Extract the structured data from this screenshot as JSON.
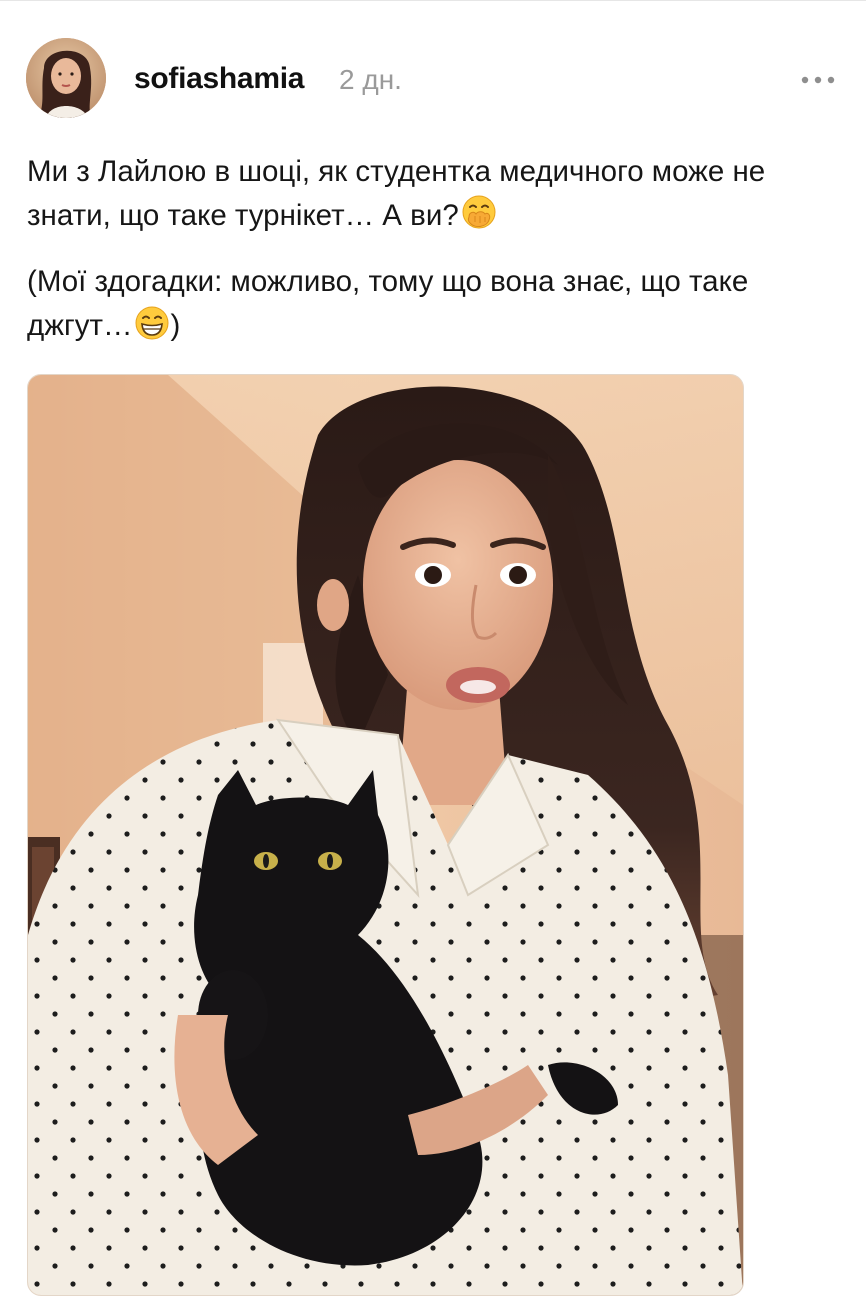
{
  "post": {
    "username": "sofiashamia",
    "time": "2 дн.",
    "paragraph_1": "Ми з Лайлою в шоці, як студентка медичного може не знати, що таке турнікет… А ви?",
    "paragraph_2": "(Мої здогадки: можливо, тому що вона знає, що таке джгут…",
    "paragraph_2_end": ")",
    "icons": {
      "avatar": "profile-photo",
      "more": "more-horizontal-icon",
      "emoji_1": "face-with-hand-over-mouth-emoji",
      "emoji_2": "grinning-face-emoji"
    }
  },
  "colors": {
    "username": "#111111",
    "time": "#9a9a9a",
    "text": "#161616",
    "icon_gray": "#8e8e8e"
  }
}
